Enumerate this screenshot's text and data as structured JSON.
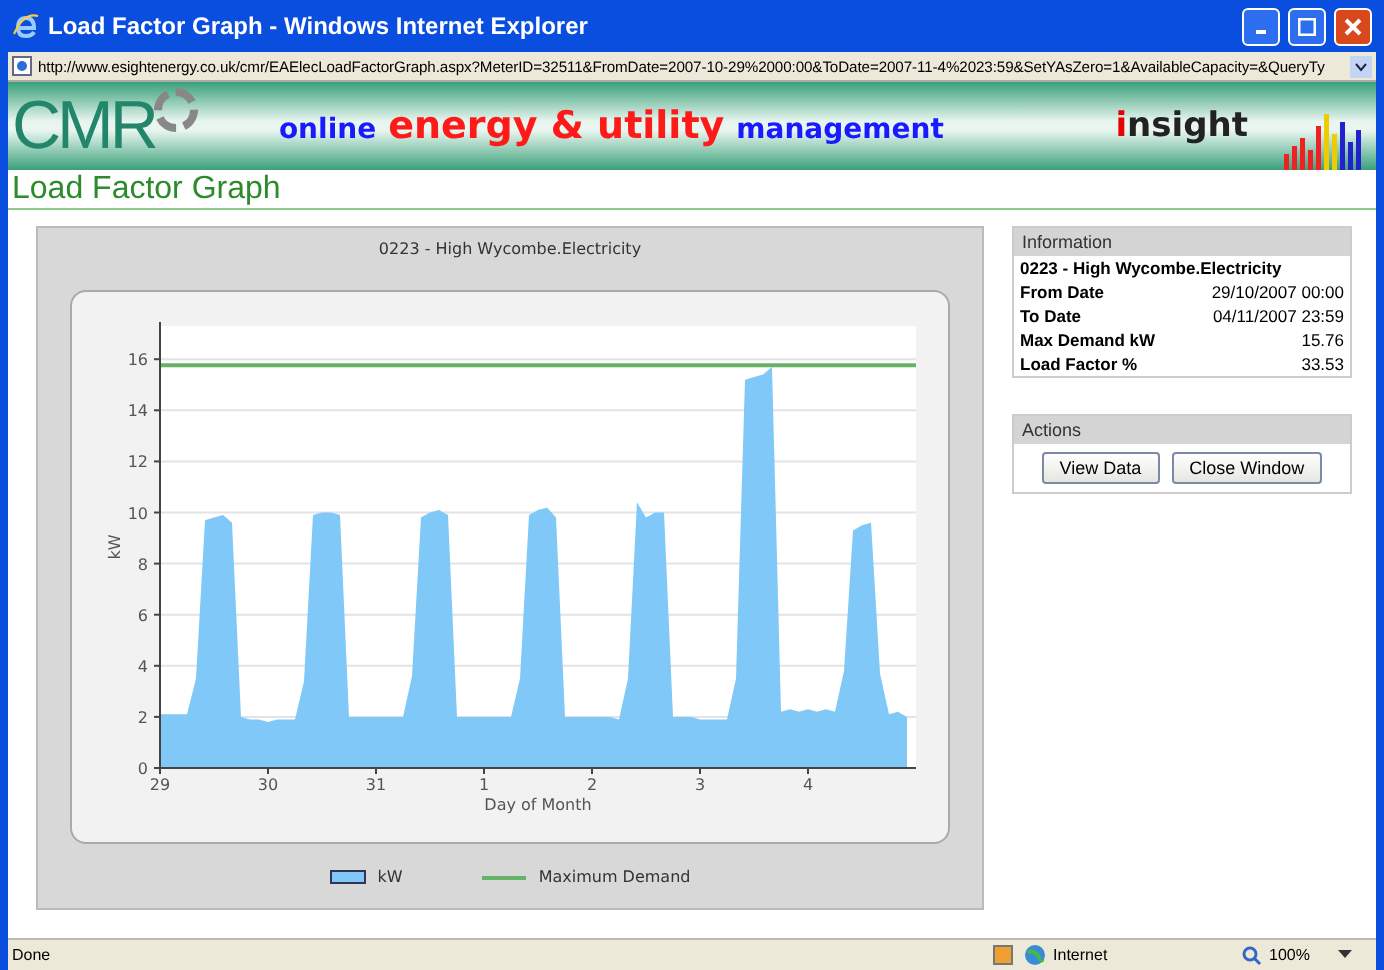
{
  "window": {
    "title": "Load Factor Graph - Windows Internet Explorer",
    "url": "http://www.esightenergy.co.uk/cmr/EAElecLoadFactorGraph.aspx?MeterID=32511&FromDate=2007-10-29%2000:00&ToDate=2007-11-4%2023:59&SetYAsZero=1&AvailableCapacity=&QueryTy"
  },
  "banner": {
    "logo": "CMR",
    "tagline": [
      {
        "text": "online",
        "color": "#1a1aff"
      },
      {
        "text": "energy & utility",
        "color": "#ff1a1a"
      },
      {
        "text": "management",
        "color": "#1a1aff"
      }
    ],
    "brand": "insight"
  },
  "page_title": "Load Factor Graph",
  "graph": {
    "title": "0223 - High Wycombe.Electricity",
    "chart_data": {
      "type": "area",
      "grid": true,
      "legend": "bottom",
      "xlabel": "Day of Month",
      "ylabel": "kW",
      "ylim": [
        0,
        17.3
      ],
      "yticks": [
        0,
        2,
        4,
        6,
        8,
        10,
        12,
        14,
        16
      ],
      "categories": [
        "29",
        null,
        null,
        null,
        null,
        null,
        null,
        null,
        null,
        null,
        null,
        null,
        "30",
        null,
        null,
        null,
        null,
        null,
        null,
        null,
        null,
        null,
        null,
        null,
        "31",
        null,
        null,
        null,
        null,
        null,
        null,
        null,
        null,
        null,
        null,
        null,
        "1",
        null,
        null,
        null,
        null,
        null,
        null,
        null,
        null,
        null,
        null,
        null,
        "2",
        null,
        null,
        null,
        null,
        null,
        null,
        null,
        null,
        null,
        null,
        null,
        "3",
        null,
        null,
        null,
        null,
        null,
        null,
        null,
        null,
        null,
        null,
        null,
        "4",
        null,
        null,
        null,
        null,
        null,
        null,
        null,
        null,
        null,
        null,
        null
      ],
      "series": [
        {
          "name": "kW",
          "color": "#7fc8f8",
          "values": [
            2.1,
            2.1,
            2.1,
            2.1,
            3.5,
            9.7,
            9.8,
            9.9,
            9.6,
            2.0,
            1.9,
            1.9,
            1.8,
            1.9,
            1.9,
            1.9,
            3.4,
            9.9,
            10.0,
            10.0,
            9.9,
            2.0,
            2.0,
            2.0,
            2.0,
            2.0,
            2.0,
            2.0,
            3.6,
            9.8,
            10.0,
            10.1,
            9.9,
            2.0,
            2.0,
            2.0,
            2.0,
            2.0,
            2.0,
            2.0,
            3.5,
            9.9,
            10.1,
            10.2,
            9.8,
            2.0,
            2.0,
            2.0,
            2.0,
            2.0,
            2.0,
            1.9,
            3.5,
            10.4,
            9.8,
            10.0,
            10.0,
            2.0,
            2.0,
            2.0,
            1.9,
            1.9,
            1.9,
            1.9,
            3.5,
            15.2,
            15.3,
            15.4,
            15.7,
            2.2,
            2.3,
            2.2,
            2.3,
            2.2,
            2.3,
            2.2,
            3.8,
            9.3,
            9.5,
            9.6,
            3.7,
            2.1,
            2.2,
            2.0
          ]
        }
      ],
      "ref_lines": [
        {
          "axis": "y",
          "value": 15.76,
          "label": "Maximum Demand",
          "color": "#66b266"
        }
      ]
    }
  },
  "information": {
    "heading": "Information",
    "meter": "0223 - High Wycombe.Electricity",
    "rows": [
      {
        "label": "From Date",
        "value": "29/10/2007 00:00"
      },
      {
        "label": "To Date",
        "value": "04/11/2007 23:59"
      },
      {
        "label": "Max Demand kW",
        "value": "15.76"
      },
      {
        "label": "Load Factor %",
        "value": "33.53"
      }
    ]
  },
  "actions": {
    "heading": "Actions",
    "buttons": [
      "View Data",
      "Close Window"
    ]
  },
  "status_bar": {
    "text": "Done",
    "zone": "Internet",
    "zoom": "100%"
  }
}
